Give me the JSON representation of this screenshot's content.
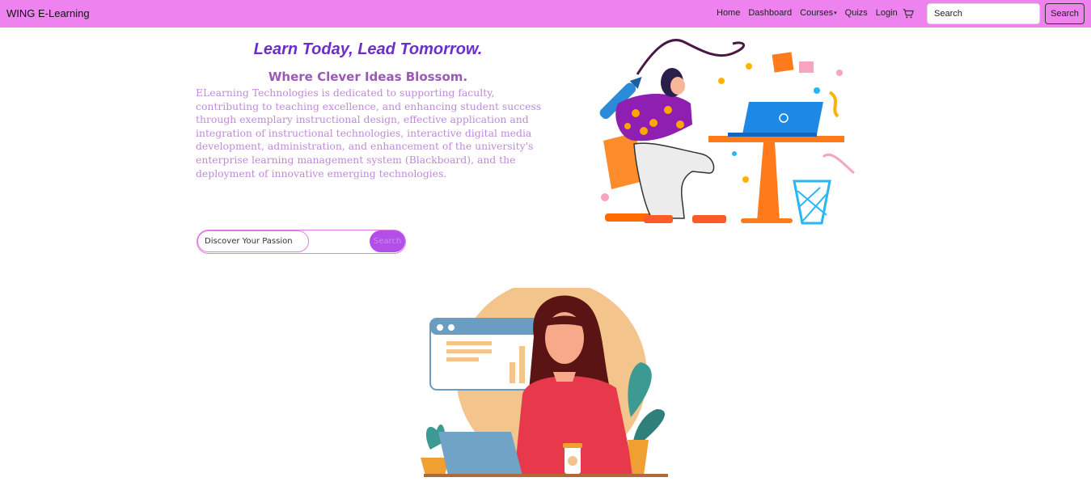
{
  "navbar": {
    "brand": "WING E-Learning",
    "links": [
      "Home",
      "Dashboard",
      "Courses",
      "Quizs",
      "Login"
    ],
    "courses_caret": "▾",
    "search_placeholder": "Search",
    "search_button": "Search",
    "background": "#ee82ee"
  },
  "hero": {
    "title": "Learn Today, Lead Tomorrow.",
    "subtitle": "Where Clever Ideas Blossom.",
    "description": "ELearning Technologies is dedicated to supporting faculty, contributing to teaching excellence, and enhancing student success through exemplary instructional design, effective application and integration of instructional technologies, interactive digital media development, administration, and enhancement of the university's enterprise learning management system (Blackboard), and the deployment of innovative emerging technologies."
  },
  "discover": {
    "placeholder": "Discover Your Passion",
    "button": "Search"
  },
  "icons": {
    "cart": "cart-icon"
  },
  "colors": {
    "title": "#6a2fc9",
    "subtitle": "#9b59b6",
    "description": "#c08ad8",
    "accent": "#b44ee8"
  }
}
